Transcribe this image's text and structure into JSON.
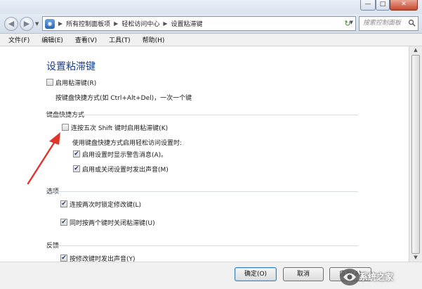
{
  "window": {
    "min_glyph": "—",
    "max_glyph": "□",
    "close_glyph": "✕"
  },
  "nav": {
    "back_glyph": "◀",
    "forward_glyph": "▶",
    "breadcrumb": [
      "所有控制面板项",
      "轻松访问中心",
      "设置粘滞键"
    ],
    "search_placeholder": "搜索控制面板"
  },
  "menu": {
    "items": [
      "文件(F)",
      "编辑(E)",
      "查看(V)",
      "工具(T)",
      "帮助(H)"
    ]
  },
  "page": {
    "title": "设置粘滞键",
    "enable_sticky": {
      "label": "启用粘滞键(R)",
      "checked": false
    },
    "enable_desc": "按键盘快捷方式(如 Ctrl+Alt+Del)，一次一个键",
    "shortcut_group": {
      "title": "键盘快捷方式",
      "shift_five": {
        "label": "连按五次 Shift 键时启用粘滞键(K)",
        "checked": false
      },
      "when_using": "使用键盘快捷方式启用轻松访问设置时:",
      "warn_msg": {
        "label": "启用设置时显示警告消息(A)。",
        "checked": true
      },
      "sound": {
        "label": "启用或关闭设置时发出声音(M)",
        "checked": true
      }
    },
    "options_group": {
      "title": "选项",
      "lock_twice": {
        "label": "连按两次时锁定修改键(L)",
        "checked": true
      },
      "turn_off_two": {
        "label": "同时按两个键时关闭粘滞键(U)",
        "checked": true
      }
    },
    "feedback_group": {
      "title": "反馈",
      "beep_modifier": {
        "label": "按修改键时发出声音(Y)",
        "checked": true
      }
    }
  },
  "buttons": {
    "ok": "确定(O)",
    "cancel": "取消",
    "apply": "应用(A)"
  },
  "watermark": "系统之家",
  "colors": {
    "title_blue": "#1a3e8c",
    "annotation_red": "#e0352b"
  }
}
